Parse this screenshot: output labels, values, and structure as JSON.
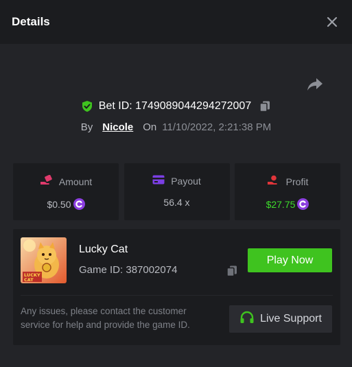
{
  "header": {
    "title": "Details"
  },
  "bet": {
    "prefix": "Bet ID: ",
    "id": "1749089044294272007",
    "by_label": "By",
    "user": "Nicole",
    "on_label": "On",
    "date": "11/10/2022, 2:21:38 PM"
  },
  "stats": {
    "amount": {
      "label": "Amount",
      "value": "$0.50"
    },
    "payout": {
      "label": "Payout",
      "value": "56.4 x"
    },
    "profit": {
      "label": "Profit",
      "value": "$27.75"
    }
  },
  "game": {
    "name": "Lucky Cat",
    "id_line": "Game ID: 387002074",
    "thumb_text_1": "LUCKY",
    "thumb_text_2": "CAT",
    "play_label": "Play Now",
    "help_text": "Any issues, please contact the customer service for help and provide the game ID.",
    "support_label": "Live Support"
  },
  "colors": {
    "accent_green": "#3fc31f",
    "profit_green": "#3edc2c",
    "coin_purple": "#8c3fe0",
    "amount_pink": "#e03a6c",
    "payout_purple": "#7b3fe4",
    "profit_red": "#e0353a"
  },
  "icons": {
    "close": "close-icon",
    "share": "share-arrow-icon",
    "verified": "shield-check-icon",
    "copy": "copy-icon",
    "amount": "hand-chip-icon",
    "payout": "card-icon",
    "profit": "hand-money-icon",
    "coin": "coin-icon",
    "support": "headset-icon"
  }
}
